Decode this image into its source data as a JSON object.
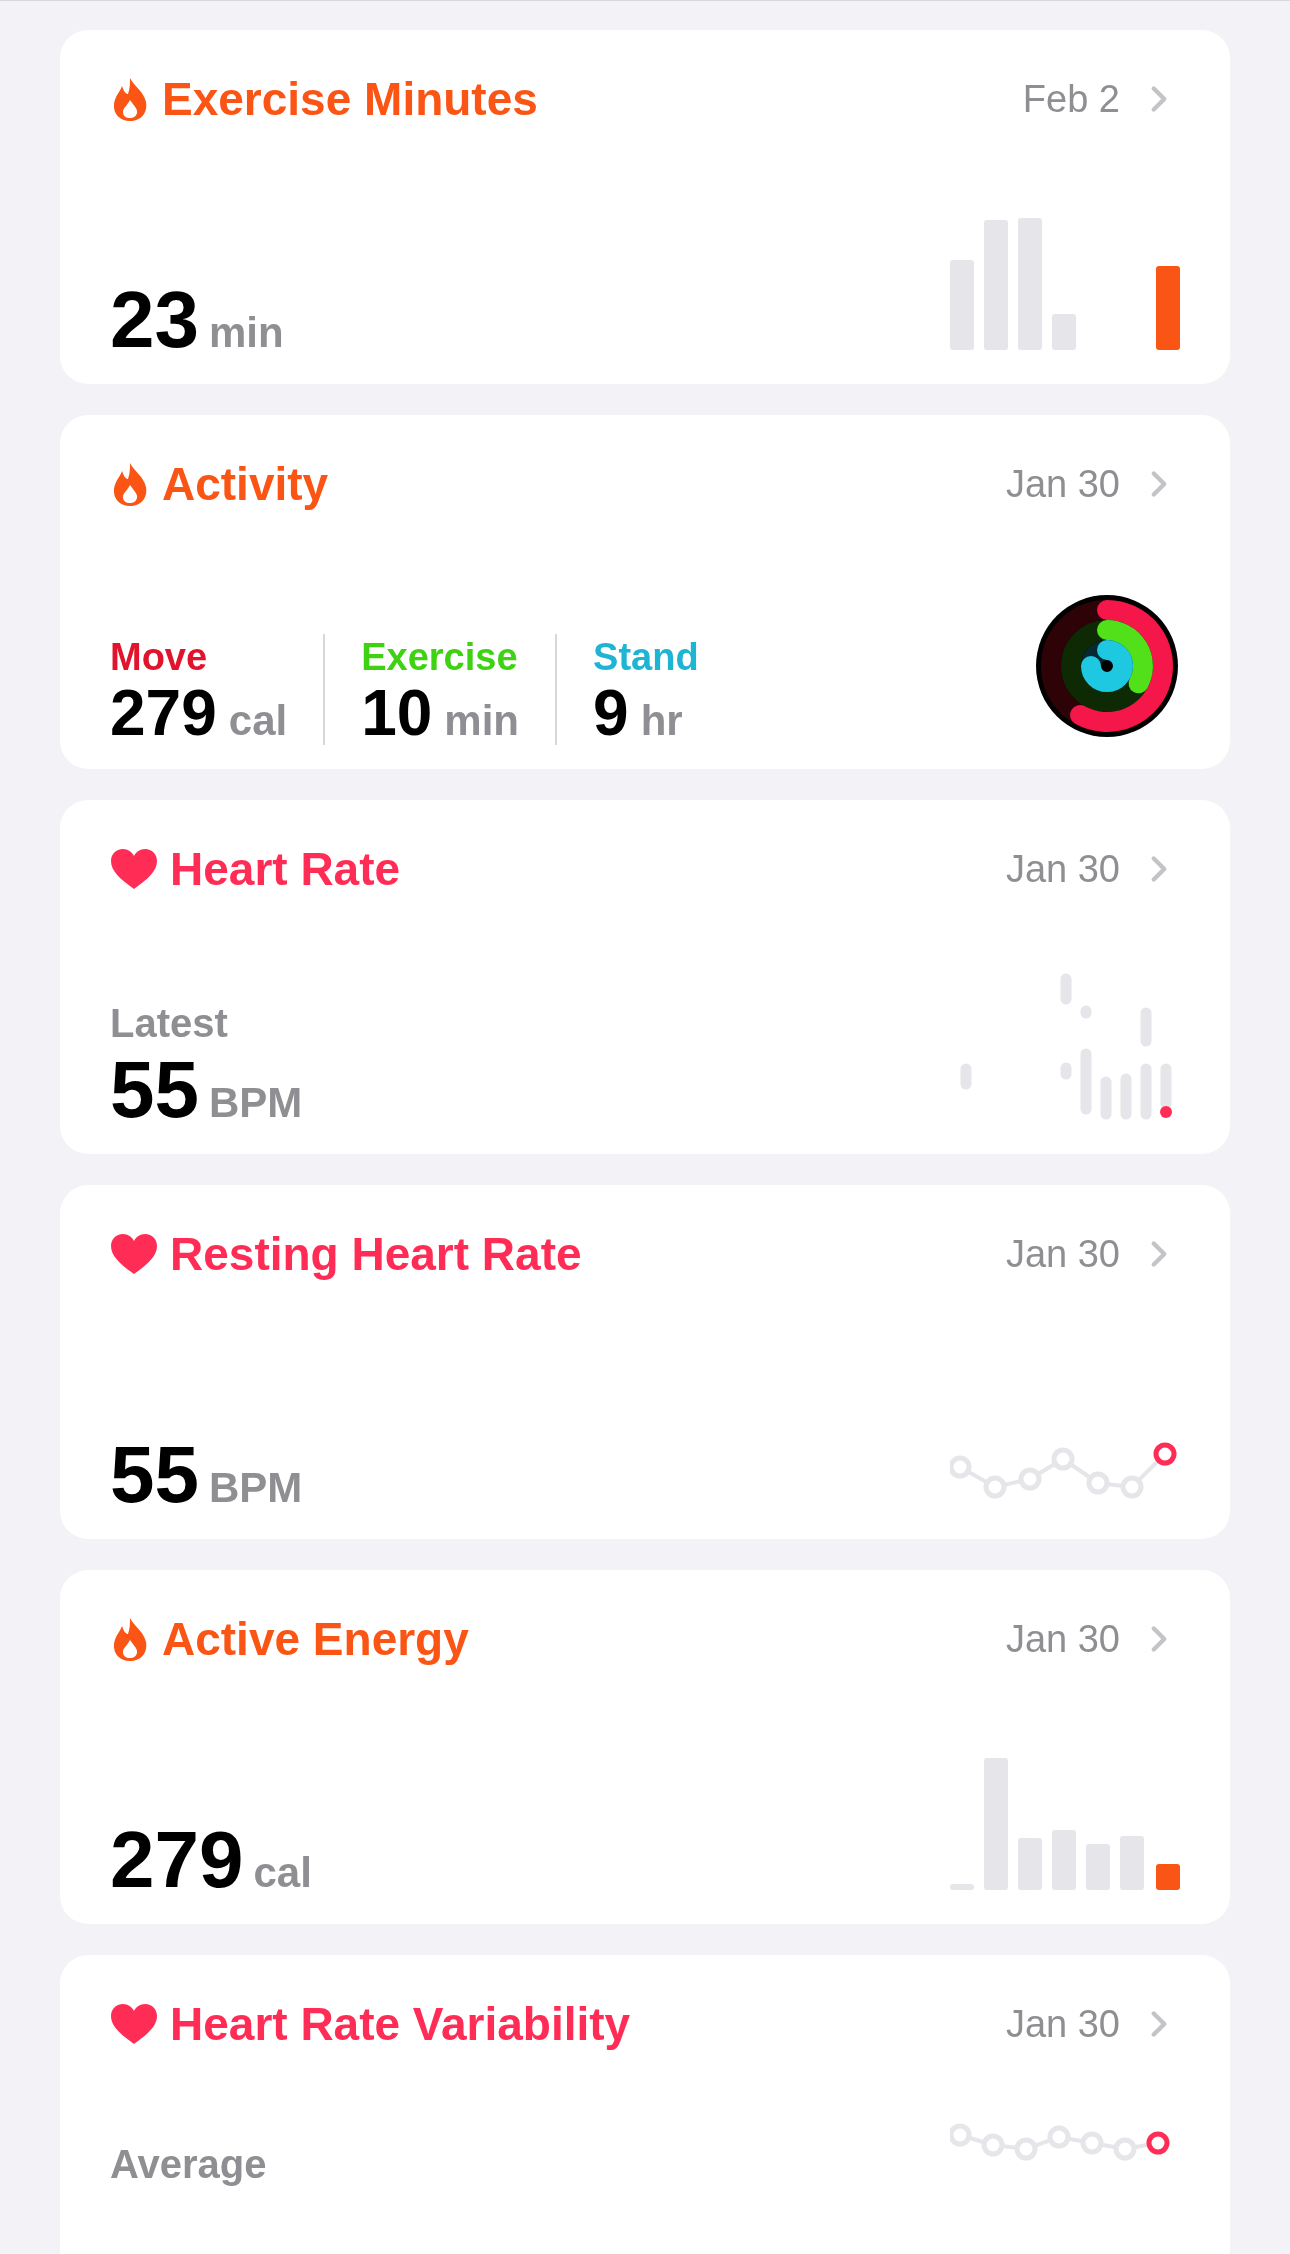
{
  "cards": [
    {
      "kind": "bars",
      "title": "Exercise Minutes",
      "date": "Feb 2",
      "value": "23",
      "unit": "min"
    },
    {
      "kind": "rings",
      "title": "Activity",
      "date": "Jan 30",
      "metrics": [
        {
          "label": "Move",
          "color": "#e0142c",
          "value": "279",
          "unit": "cal"
        },
        {
          "label": "Exercise",
          "color": "#3ed212",
          "value": "10",
          "unit": "min"
        },
        {
          "label": "Stand",
          "color": "#1eb4d4",
          "value": "9",
          "unit": "hr"
        }
      ]
    },
    {
      "kind": "dots",
      "title": "Heart Rate",
      "date": "Jan 30",
      "caption": "Latest",
      "value": "55",
      "unit": "BPM"
    },
    {
      "kind": "line",
      "title": "Resting Heart Rate",
      "date": "Jan 30",
      "value": "55",
      "unit": "BPM"
    },
    {
      "kind": "bars2",
      "title": "Active Energy",
      "date": "Jan 30",
      "value": "279",
      "unit": "cal"
    },
    {
      "kind": "line2",
      "title": "Heart Rate Variability",
      "date": "Jan 30",
      "caption": "Average"
    }
  ]
}
